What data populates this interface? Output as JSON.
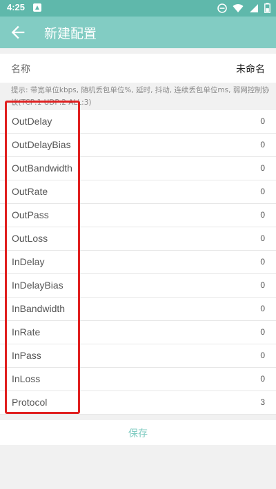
{
  "status": {
    "time": "4:25"
  },
  "appbar": {
    "title": "新建配置"
  },
  "name": {
    "label": "名称",
    "value": "未命名"
  },
  "hint": "提示: 带宽单位kbps, 随机丢包单位%, 延时, 抖动, 连续丢包单位ms, 弱网控制协议(TCP:1 UDP:2 ALL:3)",
  "params": [
    {
      "key": "OutDelay",
      "value": "0"
    },
    {
      "key": "OutDelayBias",
      "value": "0"
    },
    {
      "key": "OutBandwidth",
      "value": "0"
    },
    {
      "key": "OutRate",
      "value": "0"
    },
    {
      "key": "OutPass",
      "value": "0"
    },
    {
      "key": "OutLoss",
      "value": "0"
    },
    {
      "key": "InDelay",
      "value": "0"
    },
    {
      "key": "InDelayBias",
      "value": "0"
    },
    {
      "key": "InBandwidth",
      "value": "0"
    },
    {
      "key": "InRate",
      "value": "0"
    },
    {
      "key": "InPass",
      "value": "0"
    },
    {
      "key": "InLoss",
      "value": "0"
    },
    {
      "key": "Protocol",
      "value": "3"
    }
  ],
  "save_label": "保存",
  "colors": {
    "statusbar": "#5fb8ab",
    "appbar": "#82ccc3",
    "highlight": "#e02020",
    "save_text": "#7fcbc1"
  }
}
